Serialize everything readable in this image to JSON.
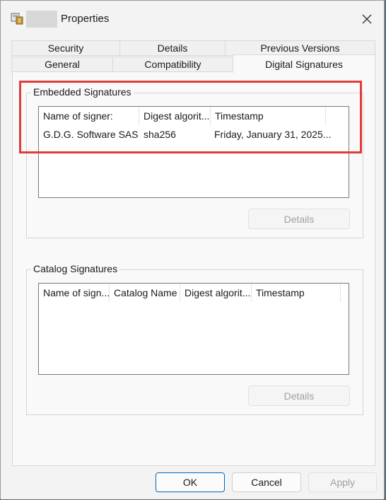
{
  "window": {
    "title": "Properties"
  },
  "tabs": {
    "row1": [
      {
        "label": "Security"
      },
      {
        "label": "Details"
      },
      {
        "label": "Previous Versions"
      }
    ],
    "row2": [
      {
        "label": "General"
      },
      {
        "label": "Compatibility"
      },
      {
        "label": "Digital Signatures"
      }
    ],
    "active": "Digital Signatures"
  },
  "embedded": {
    "label": "Embedded Signatures",
    "columns": [
      "Name of signer:",
      "Digest algorit...",
      "Timestamp"
    ],
    "rows": [
      {
        "name": "G.D.G. Software SAS",
        "digest": "sha256",
        "timestamp": "Friday, January 31, 2025..."
      }
    ],
    "details_button": "Details"
  },
  "catalog": {
    "label": "Catalog Signatures",
    "columns": [
      "Name of sign...",
      "Catalog Name",
      "Digest algorit...",
      "Timestamp"
    ],
    "rows": [],
    "details_button": "Details"
  },
  "buttons": {
    "ok": "OK",
    "cancel": "Cancel",
    "apply": "Apply"
  },
  "colors": {
    "highlight": "#e03c3c",
    "accent": "#0067c0"
  }
}
